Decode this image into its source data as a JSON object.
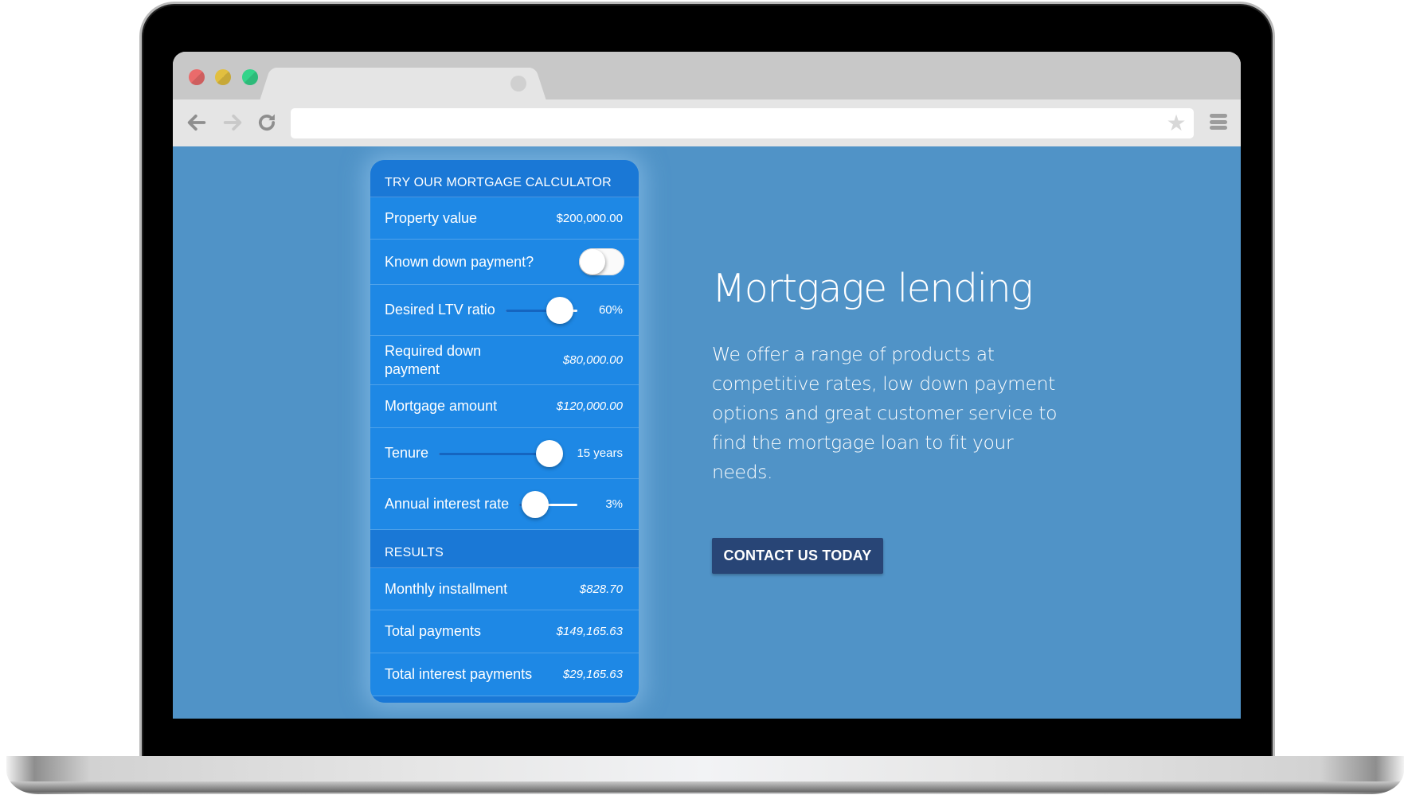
{
  "browser": {
    "url": "",
    "icons": {
      "back": "arrow-left-icon",
      "forward": "arrow-right-icon",
      "reload": "reload-icon",
      "bookmark": "star-icon",
      "menu": "hamburger-menu-icon",
      "tab_close": "tab-close-icon"
    },
    "star_glyph": "★"
  },
  "calculator": {
    "title": "TRY OUR MORTGAGE CALCULATOR",
    "property_value": {
      "label": "Property value",
      "value": "$200,000.00"
    },
    "known_down_payment": {
      "label": "Known down payment?",
      "enabled": false
    },
    "ltv": {
      "label": "Desired LTV ratio",
      "value": "60%",
      "fraction": 0.75
    },
    "required_down_payment": {
      "label": "Required down payment",
      "value": "$80,000.00"
    },
    "mortgage_amount": {
      "label": "Mortgage amount",
      "value": "$120,000.00"
    },
    "tenure": {
      "label": "Tenure",
      "value": "15 years",
      "fraction": 0.9
    },
    "interest_rate": {
      "label": "Annual interest rate",
      "value": "3%",
      "fraction": 0.27
    },
    "results": {
      "title": "RESULTS",
      "monthly_installment": {
        "label": "Monthly installment",
        "value": "$828.70"
      },
      "total_payments": {
        "label": "Total payments",
        "value": "$149,165.63"
      },
      "total_interest": {
        "label": "Total interest payments",
        "value": "$29,165.63"
      }
    }
  },
  "hero": {
    "title": "Mortgage lending",
    "text": "We offer a range of products at competitive rates, low down payment options and great customer service to find the mortgage loan to fit your needs.",
    "cta_label": "CONTACT US TODAY"
  },
  "colors": {
    "page_background": "#5093c7",
    "card": "#1e88e5",
    "card_header": "#1a78d6",
    "cta": "#284576"
  }
}
